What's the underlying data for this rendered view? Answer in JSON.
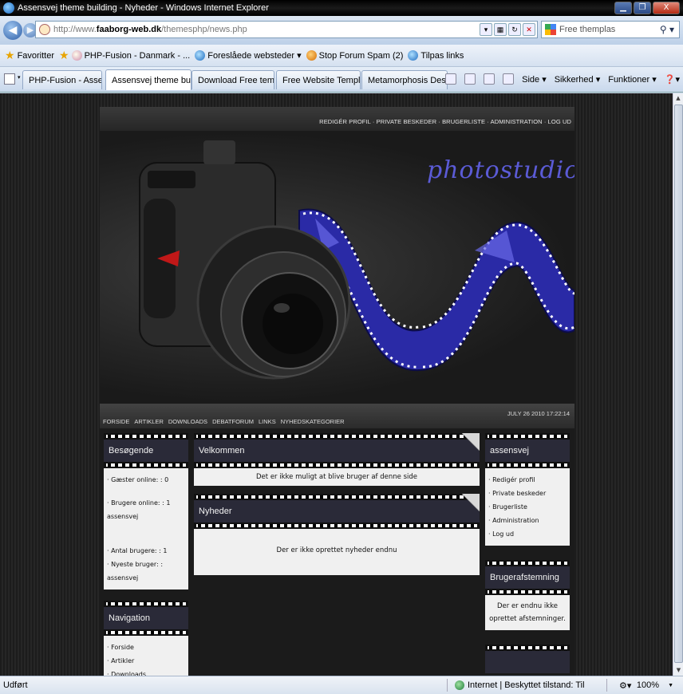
{
  "window": {
    "title": "Assensvej theme building - Nyheder - Windows Internet Explorer",
    "minimize": "▁",
    "restore": "❐",
    "close": "X"
  },
  "address": {
    "url_prefix": "http://www.",
    "url_host": "faaborg-web.dk",
    "url_path": "/themesphp/news.php",
    "search_placeholder": "Free themplas"
  },
  "favorites": {
    "favorites_label": "Favoritter",
    "items": [
      "PHP-Fusion - Danmark - ...",
      "Foreslåede websteder ▾",
      "Stop Forum Spam (2)",
      "Tilpas links"
    ]
  },
  "tabs": [
    {
      "label": "PHP-Fusion - Assensvej.dk",
      "active": false
    },
    {
      "label": "Assensvej theme buildi...",
      "active": true
    },
    {
      "label": "Download Free templates ...",
      "active": false
    },
    {
      "label": "Free Website Templates, Fr...",
      "active": false
    },
    {
      "label": "Metamorphosis Design Fre...",
      "active": false
    }
  ],
  "toolbar": {
    "side": "Side ▾",
    "sikkerhed": "Sikkerhed ▾",
    "funktioner": "Funktioner ▾"
  },
  "site": {
    "topnav": "REDIGÉR PROFIL · PRIVATE BESKEDER · BRUGERLISTE · ADMINISTRATION · LOG UD",
    "brand": "photostudio",
    "mainnav": [
      "FORSIDE",
      "ARTIKLER",
      "DOWNLOADS",
      "DEBATFORUM",
      "LINKS",
      "NYHEDSKATEGORIER"
    ],
    "date": "JULY 26 2010 17:22:14",
    "left": {
      "visitors_title": "Besøgende",
      "guests": "· Gæster online: : 0",
      "members": "· Brugere online: : 1",
      "member_name": "assensvej",
      "total": "· Antal brugere: : 1",
      "newest": "· Nyeste bruger: : assensvej",
      "nav_title": "Navigation",
      "nav_items": [
        "· Forside",
        "· Artikler",
        "· Downloads"
      ]
    },
    "center": {
      "welcome_title": "Velkommen",
      "welcome_msg": "Det er ikke muligt at blive bruger af denne side",
      "news_title": "Nyheder",
      "news_msg": "Der er ikke oprettet nyheder endnu"
    },
    "right": {
      "user_title": "assensvej",
      "user_items": [
        "· Redigér profil",
        "· Private beskeder",
        "· Brugerliste",
        "· Administration",
        "· Log ud"
      ],
      "poll_title": "Brugerafstemning",
      "poll_msg": "Der er endnu ikke oprettet afstemninger."
    }
  },
  "status": {
    "done": "Udført",
    "zone": "Internet | Beskyttet tilstand: Til",
    "zoom": "100%"
  }
}
